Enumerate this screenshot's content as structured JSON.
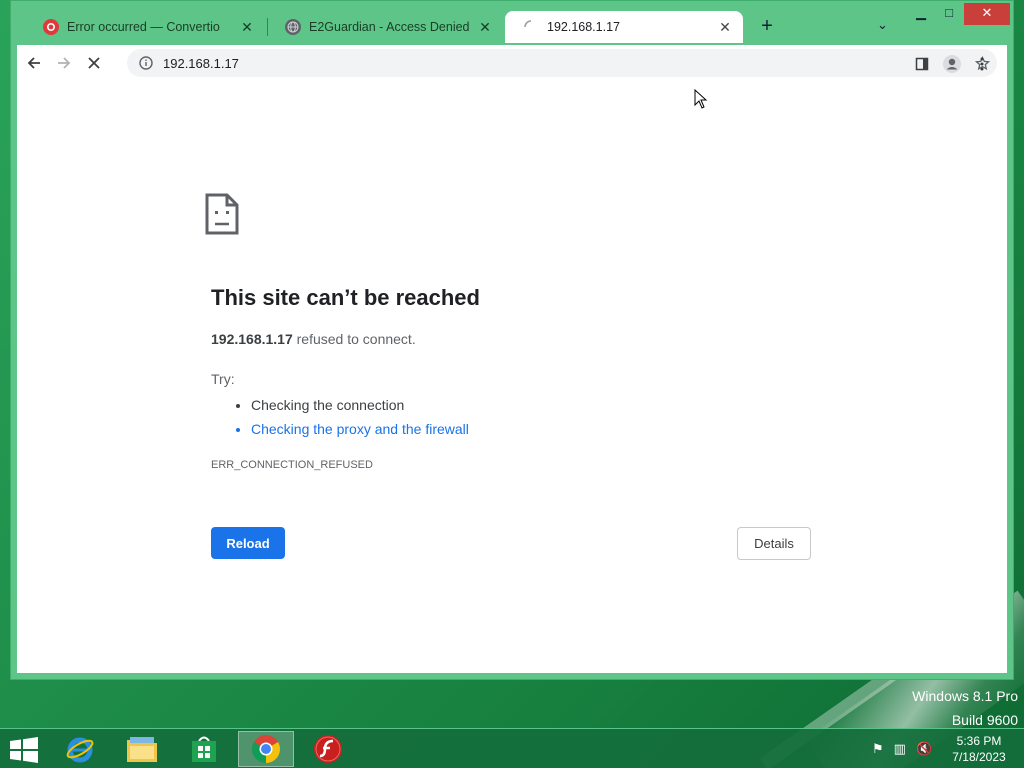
{
  "tabs": [
    {
      "label": "Error occurred — Convertio",
      "icon": "convertio-icon",
      "active": false
    },
    {
      "label": "E2Guardian - Access Denied",
      "icon": "globe-icon",
      "active": false
    },
    {
      "label": "192.168.1.17",
      "icon": "loading-spinner-icon",
      "active": true
    }
  ],
  "omnibox": {
    "url": "192.168.1.17"
  },
  "error_page": {
    "title": "This site can’t be reached",
    "host": "192.168.1.17",
    "message": " refused to connect.",
    "try_label": "Try:",
    "suggestions": [
      "Checking the connection",
      "Checking the proxy and the firewall"
    ],
    "error_code": "ERR_CONNECTION_REFUSED",
    "reload_label": "Reload",
    "details_label": "Details"
  },
  "watermark": {
    "line1": "Windows 8.1 Pro",
    "line2": "Build 9600"
  },
  "clock": {
    "time": "5:36 PM",
    "date": "7/18/2023"
  },
  "colors": {
    "accent": "#1a73e8",
    "window_frame": "#5cc587",
    "taskbar": "#146e3c"
  }
}
